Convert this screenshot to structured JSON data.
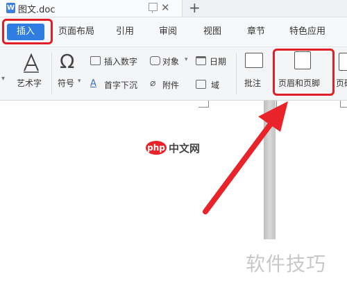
{
  "window": {
    "doc_icon": "W",
    "doc_title": "图文.doc",
    "close_glyph": "✕",
    "new_tab_glyph": "+"
  },
  "menu": {
    "tabs": [
      "插入",
      "页面布局",
      "引用",
      "审阅",
      "视图",
      "章节",
      "特色应用"
    ],
    "active": "插入"
  },
  "ribbon": {
    "wordart": "艺术字",
    "symbol": "符号",
    "symbol_glyph": "Ω",
    "insert_number": "插入数字",
    "object": "对象",
    "date": "日期",
    "drop_cap": "首字下沉",
    "attachment": "附件",
    "field": "域",
    "comment": "批注",
    "header_footer": "页眉和页脚",
    "page_partial": "页码"
  },
  "watermark": {
    "logo": "php",
    "site": "中文网",
    "bottom": "软件技巧"
  },
  "colors": {
    "accent": "#2f7de1",
    "highlight_red": "#e01e25"
  }
}
